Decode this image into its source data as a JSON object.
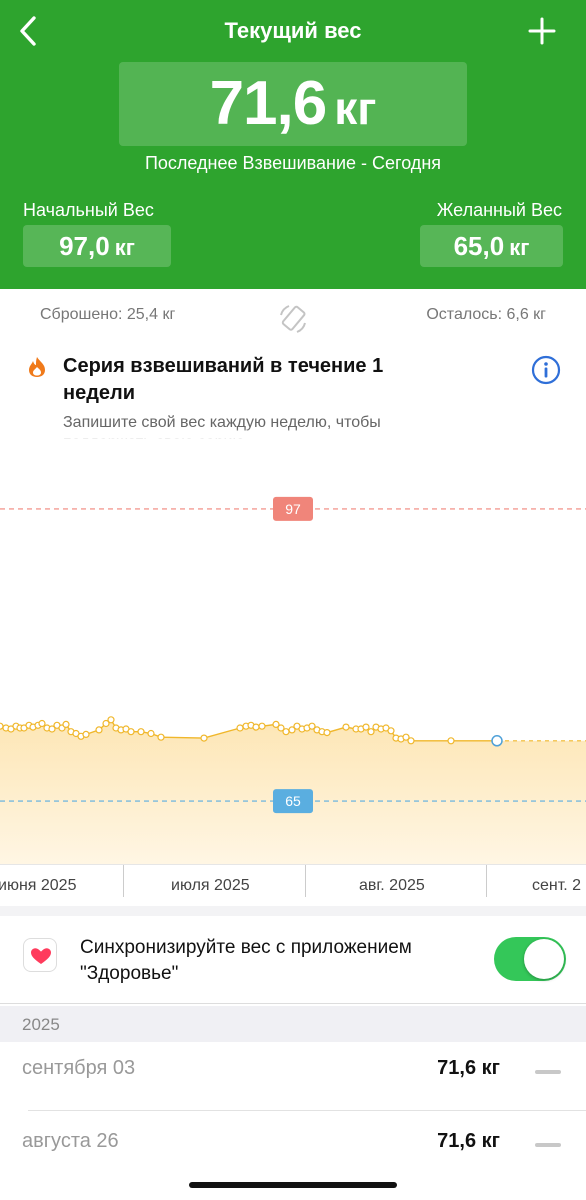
{
  "header": {
    "title": "Текущий вес",
    "current_weight": "71,6",
    "current_unit": "кг",
    "last_weighing": "Последнее Взвешивание - Сегодня",
    "start": {
      "label": "Начальный Вес",
      "value": "97,0",
      "unit": "кг"
    },
    "goal": {
      "label": "Желанный Вес",
      "value": "65,0",
      "unit": "кг"
    },
    "accent_color": "#2ea42e"
  },
  "stats": {
    "lost": "Сброшено: 25,4 кг",
    "remaining": "Осталось: 6,6 кг"
  },
  "streak": {
    "title": "Серия взвешиваний в течение 1 недели",
    "description": "Запишите свой вес каждую неделю, чтобы поддержать свою серию"
  },
  "chart_data": {
    "type": "line",
    "start_line": {
      "value": 97,
      "label": "97",
      "color": "#f0857a"
    },
    "goal_line": {
      "value": 65,
      "label": "65",
      "color": "#5aaee0"
    },
    "line_color": "#f0b72b",
    "ylim": [
      58,
      104
    ],
    "x_ticks": [
      "июня 2025",
      "июля 2025",
      "авг. 2025",
      "сент. 2"
    ],
    "series": [
      {
        "points": [
          [
            0,
            73.2
          ],
          [
            6,
            73.0
          ],
          [
            11,
            72.9
          ],
          [
            16,
            73.2
          ],
          [
            20,
            73.0
          ],
          [
            24,
            73.0
          ],
          [
            29,
            73.3
          ],
          [
            33,
            73.1
          ],
          [
            38,
            73.3
          ],
          [
            42,
            73.5
          ],
          [
            47,
            73.0
          ],
          [
            52,
            72.9
          ],
          [
            57,
            73.3
          ],
          [
            62,
            73.0
          ],
          [
            66,
            73.4
          ],
          [
            71,
            72.6
          ],
          [
            76,
            72.4
          ],
          [
            81,
            72.1
          ],
          [
            86,
            72.3
          ],
          [
            99,
            72.8
          ],
          [
            106,
            73.5
          ],
          [
            111,
            73.9
          ],
          [
            116,
            73.0
          ],
          [
            121,
            72.8
          ],
          [
            126,
            72.9
          ],
          [
            131,
            72.6
          ],
          [
            141,
            72.6
          ],
          [
            151,
            72.4
          ],
          [
            161,
            72.0
          ],
          [
            204,
            71.9
          ],
          [
            240,
            73.0
          ],
          [
            246,
            73.2
          ],
          [
            251,
            73.3
          ],
          [
            256,
            73.1
          ],
          [
            262,
            73.2
          ],
          [
            276,
            73.4
          ],
          [
            281,
            73.0
          ],
          [
            286,
            72.6
          ],
          [
            292,
            72.8
          ],
          [
            297,
            73.2
          ],
          [
            302,
            72.9
          ],
          [
            307,
            73.0
          ],
          [
            312,
            73.2
          ],
          [
            317,
            72.8
          ],
          [
            322,
            72.6
          ],
          [
            327,
            72.5
          ],
          [
            346,
            73.1
          ],
          [
            356,
            72.9
          ],
          [
            361,
            72.9
          ],
          [
            366,
            73.1
          ],
          [
            371,
            72.6
          ],
          [
            376,
            73.1
          ],
          [
            381,
            72.9
          ],
          [
            386,
            73.0
          ],
          [
            391,
            72.7
          ],
          [
            396,
            71.9
          ],
          [
            401,
            71.8
          ],
          [
            406,
            72.0
          ],
          [
            411,
            71.6
          ],
          [
            451,
            71.6
          ],
          [
            497,
            71.6
          ]
        ]
      }
    ]
  },
  "sync": {
    "text": "Синхронизируйте вес с приложением \"Здоровье\"",
    "enabled": true
  },
  "history": {
    "year": "2025",
    "entries": [
      {
        "date": "сентября 03",
        "weight": "71,6 кг"
      },
      {
        "date": "августа 26",
        "weight": "71,6 кг"
      }
    ]
  }
}
